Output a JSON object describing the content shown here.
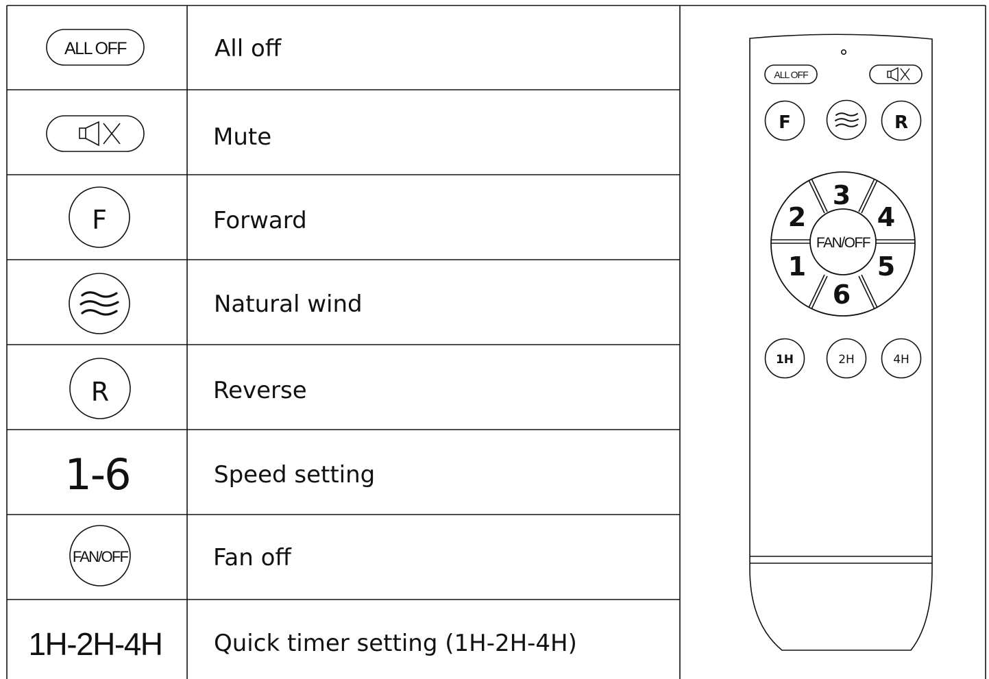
{
  "rows": [
    {
      "button_text": "ALL OFF",
      "icon": "all-off-pill-button",
      "description": "All off"
    },
    {
      "button_text": "",
      "icon": "mute-speaker-pill-button",
      "description": "Mute"
    },
    {
      "button_text": "F",
      "icon": "forward-circle-button",
      "description": "Forward"
    },
    {
      "button_text": "",
      "icon": "natural-wind-circle-button",
      "description": "Natural wind"
    },
    {
      "button_text": "R",
      "icon": "reverse-circle-button",
      "description": "Reverse"
    },
    {
      "button_text": "1-6",
      "icon": "speed-text",
      "description": "Speed setting"
    },
    {
      "button_text": "FAN/OFF",
      "icon": "fan-off-circle-button",
      "description": "Fan off"
    },
    {
      "button_text": "1H-2H-4H",
      "icon": "timer-text",
      "description": "Quick timer setting (1H-2H-4H)"
    }
  ],
  "remote": {
    "all_off": "ALL OFF",
    "forward": "F",
    "reverse": "R",
    "fan_off": "FAN/OFF",
    "speeds": [
      "1",
      "2",
      "3",
      "4",
      "5",
      "6"
    ],
    "timers": [
      "1H",
      "2H",
      "4H"
    ]
  }
}
